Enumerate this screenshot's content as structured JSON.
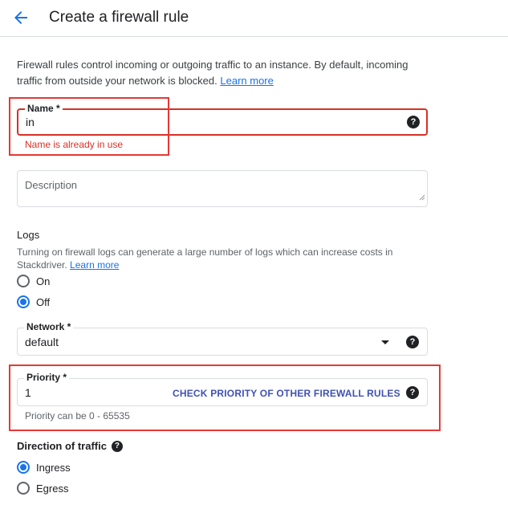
{
  "header": {
    "back_icon": "arrow-back-icon",
    "title": "Create a firewall rule"
  },
  "intro": {
    "text": "Firewall rules control incoming or outgoing traffic to an instance. By default, incoming traffic from outside your network is blocked.",
    "learn_more": "Learn more"
  },
  "name_field": {
    "label": "Name *",
    "value": "in",
    "error": "Name is already in use"
  },
  "description_field": {
    "placeholder": "Description"
  },
  "logs": {
    "title": "Logs",
    "description": "Turning on firewall logs can generate a large number of logs which can increase costs in Stackdriver.",
    "learn_more": "Learn more",
    "options": [
      {
        "label": "On",
        "checked": false
      },
      {
        "label": "Off",
        "checked": true
      }
    ]
  },
  "network_field": {
    "label": "Network *",
    "value": "default"
  },
  "priority_field": {
    "label": "Priority *",
    "value": "1",
    "action": "CHECK PRIORITY OF OTHER FIREWALL RULES",
    "hint": "Priority can be 0 - 65535"
  },
  "direction": {
    "title": "Direction of traffic",
    "options": [
      {
        "label": "Ingress",
        "checked": true
      },
      {
        "label": "Egress",
        "checked": false
      }
    ]
  },
  "help_glyph": "?",
  "colors": {
    "accent": "#1a73e8",
    "error": "#d93025",
    "highlight_box": "#e53935"
  }
}
